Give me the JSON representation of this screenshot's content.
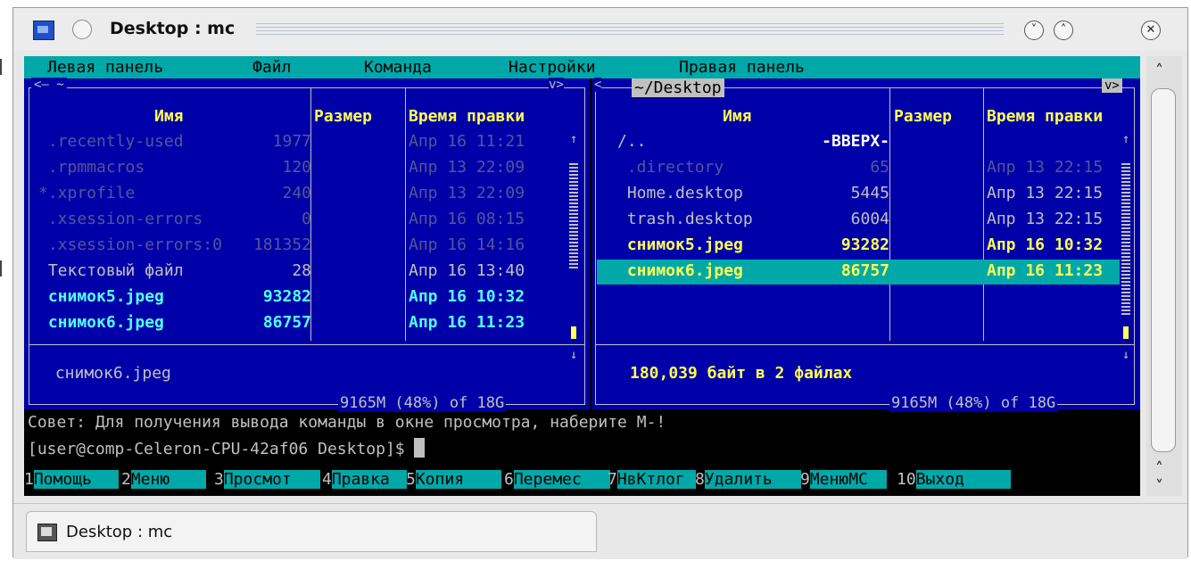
{
  "window": {
    "title": "Desktop : mc"
  },
  "menubar": [
    "Левая панель",
    "Файл",
    "Команда",
    "Настройки",
    "Правая панель"
  ],
  "left_panel": {
    "top_label": "<— ~",
    "top_right": "v>",
    "headers": {
      "name": "Имя",
      "size": "Размер",
      "time": "Время правки"
    },
    "files": [
      {
        "name": " .recently-used",
        "size": "1977",
        "time": "Апр 16 11:21",
        "kind": "dim"
      },
      {
        "name": " .rpmmacros",
        "size": "120",
        "time": "Апр 13 22:09",
        "kind": "dim"
      },
      {
        "name": "*.xprofile",
        "size": "240",
        "time": "Апр 13 22:09",
        "kind": "dim"
      },
      {
        "name": " .xsession-errors",
        "size": "0",
        "time": "Апр 16 08:15",
        "kind": "dim"
      },
      {
        "name": " .xsession-errors:0",
        "size": "181352",
        "time": "Апр 16 14:16",
        "kind": "dim"
      },
      {
        "name": " Текстовый файл",
        "size": "28",
        "time": "Апр 16 13:40",
        "kind": "norm"
      },
      {
        "name": " снимок5.jpeg",
        "size": "93282",
        "time": "Апр 16 10:32",
        "kind": "img"
      },
      {
        "name": " снимок6.jpeg",
        "size": "86757",
        "time": "Апр 16 11:23",
        "kind": "img"
      }
    ],
    "mini_status": " снимок6.jpeg",
    "disk": "9165M (48%) of 18G"
  },
  "right_panel": {
    "path": "~/Desktop",
    "top_right": "v>",
    "headers": {
      "name": "Имя",
      "size": "Размер",
      "time": "Время правки"
    },
    "files": [
      {
        "name": "/..",
        "size": "-ВВЕРХ-",
        "time": "",
        "kind": "up"
      },
      {
        "name": " .directory",
        "size": "65",
        "time": "Апр 13 22:15",
        "kind": "dim"
      },
      {
        "name": " Home.desktop",
        "size": "5445",
        "time": "Апр 13 22:15",
        "kind": "norm"
      },
      {
        "name": " trash.desktop",
        "size": "6004",
        "time": "Апр 13 22:15",
        "kind": "norm"
      },
      {
        "name": " снимок5.jpeg",
        "size": "93282",
        "time": "Апр 16 10:32",
        "kind": "yel"
      },
      {
        "name": " снимок6.jpeg",
        "size": "86757",
        "time": "Апр 16 11:23",
        "kind": "sel"
      }
    ],
    "mini_status": "180,039 байт в 2 файлах",
    "disk": "9165M (48%) of 18G"
  },
  "hint": "Совет: Для получения вывода команды в окне просмотра, наберите M-!",
  "prompt": "[user@comp-Celeron-CPU-42af06 Desktop]$ ",
  "fkeys": [
    {
      "num": "1",
      "label": "Помощь"
    },
    {
      "num": "2",
      "label": "Меню  "
    },
    {
      "num": "3",
      "label": "Просмот"
    },
    {
      "num": "4",
      "label": "Правка"
    },
    {
      "num": "5",
      "label": "Копия  "
    },
    {
      "num": "6",
      "label": "Перемес"
    },
    {
      "num": "7",
      "label": "НвКтлог"
    },
    {
      "num": "8",
      "label": "Удалить"
    },
    {
      "num": "9",
      "label": "МенюМС"
    },
    {
      "num": "10",
      "label": "Выход  "
    }
  ],
  "taskbar": {
    "task_title": "Desktop : mc"
  },
  "icons": {
    "app": "terminal-app-icon",
    "minimize": "chevron-down-icon",
    "maximize": "chevron-up-icon",
    "close": "close-icon"
  }
}
